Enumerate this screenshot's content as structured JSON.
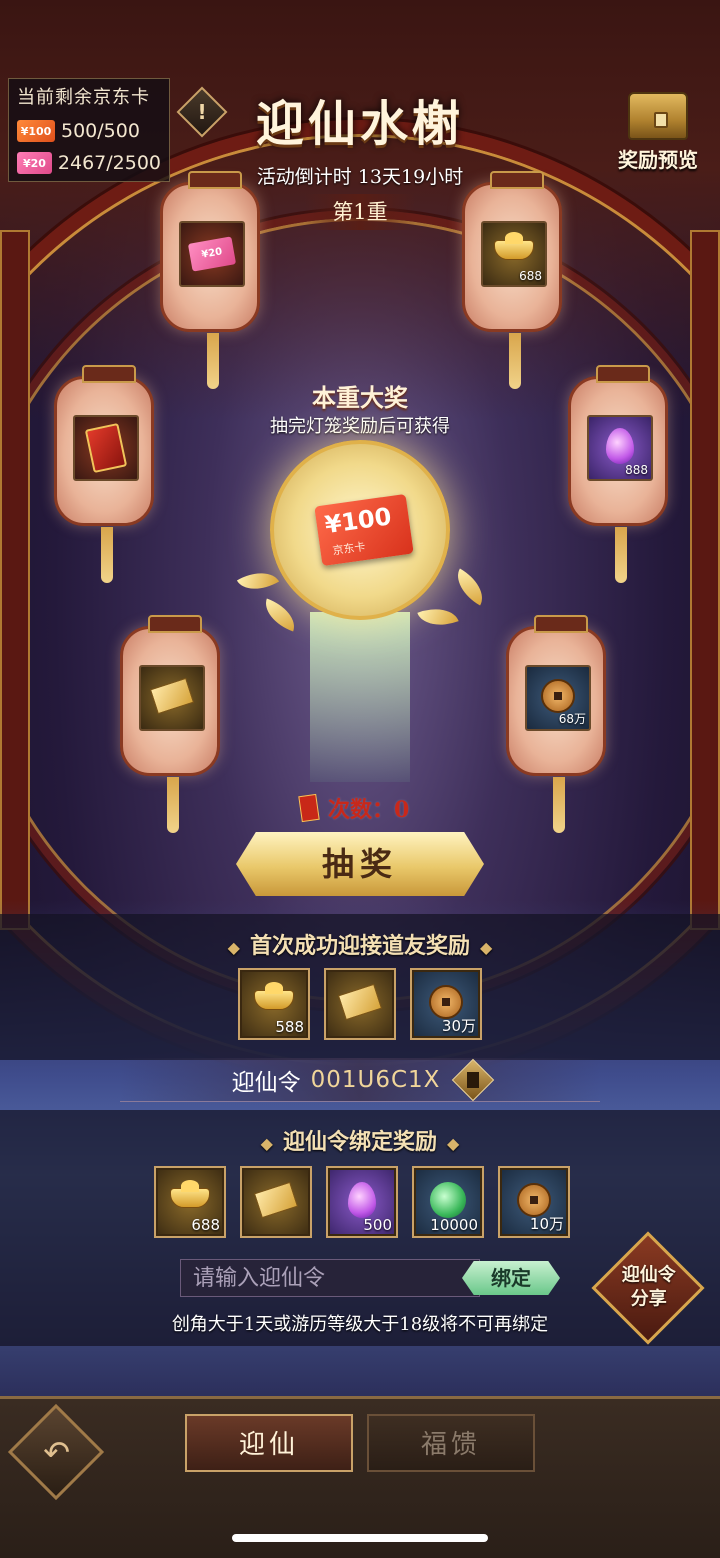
{
  "app": {
    "title": "迎仙水榭",
    "countdown": "活动倒计时 13天19小时",
    "tier": "第1重"
  },
  "jd_panel": {
    "title": "当前剩余京东卡",
    "cards": [
      {
        "label": "¥100",
        "value": "500/500",
        "color": "#e8642a"
      },
      {
        "label": "¥20",
        "value": "2467/2500",
        "color": "#e85a9a"
      }
    ]
  },
  "info_icon": "!",
  "preview": {
    "label": "奖励预览",
    "icon": "treasure-chest-icon"
  },
  "lanterns": [
    {
      "icon": "jd-card-20-icon",
      "card_text": "¥20",
      "count": ""
    },
    {
      "icon": "gold-ingot-icon",
      "count": "688"
    },
    {
      "icon": "red-packet-icon",
      "count": ""
    },
    {
      "icon": "purple-crystal-icon",
      "count": "888"
    },
    {
      "icon": "gold-ticket-icon",
      "count": ""
    },
    {
      "icon": "copper-coin-icon",
      "count": "68万"
    }
  ],
  "grand_prize": {
    "title": "本重大奖",
    "subtitle": "抽完灯笼奖励后可获得",
    "card_amount": "¥100",
    "card_brand": "京东卡"
  },
  "draws": {
    "label": "次数：0"
  },
  "draw_button": "抽奖",
  "first_reward": {
    "title": "首次成功迎接道友奖励",
    "items": [
      {
        "icon": "gold-ingot-icon",
        "count": "588"
      },
      {
        "icon": "gold-ticket-icon",
        "count": ""
      },
      {
        "icon": "copper-coin-icon",
        "count": "30万"
      }
    ]
  },
  "invite_code": {
    "label": "迎仙令",
    "code": "001U6C1X",
    "copy_icon": "copy-icon"
  },
  "bind_reward": {
    "title": "迎仙令绑定奖励",
    "items": [
      {
        "icon": "gold-ingot-icon",
        "count": "688"
      },
      {
        "icon": "gold-ticket-icon",
        "count": ""
      },
      {
        "icon": "purple-crystal-icon",
        "count": "500"
      },
      {
        "icon": "jade-orb-icon",
        "count": "10000"
      },
      {
        "icon": "copper-coin-icon",
        "count": "10万"
      }
    ]
  },
  "bind": {
    "placeholder": "请输入迎仙令",
    "button": "绑定",
    "note": "创角大于1天或游历等级大于18级将不可再绑定"
  },
  "share": {
    "line1": "迎仙令",
    "line2": "分享"
  },
  "tabs": {
    "active": "迎仙",
    "inactive": "福馈"
  },
  "back_icon": "↶"
}
